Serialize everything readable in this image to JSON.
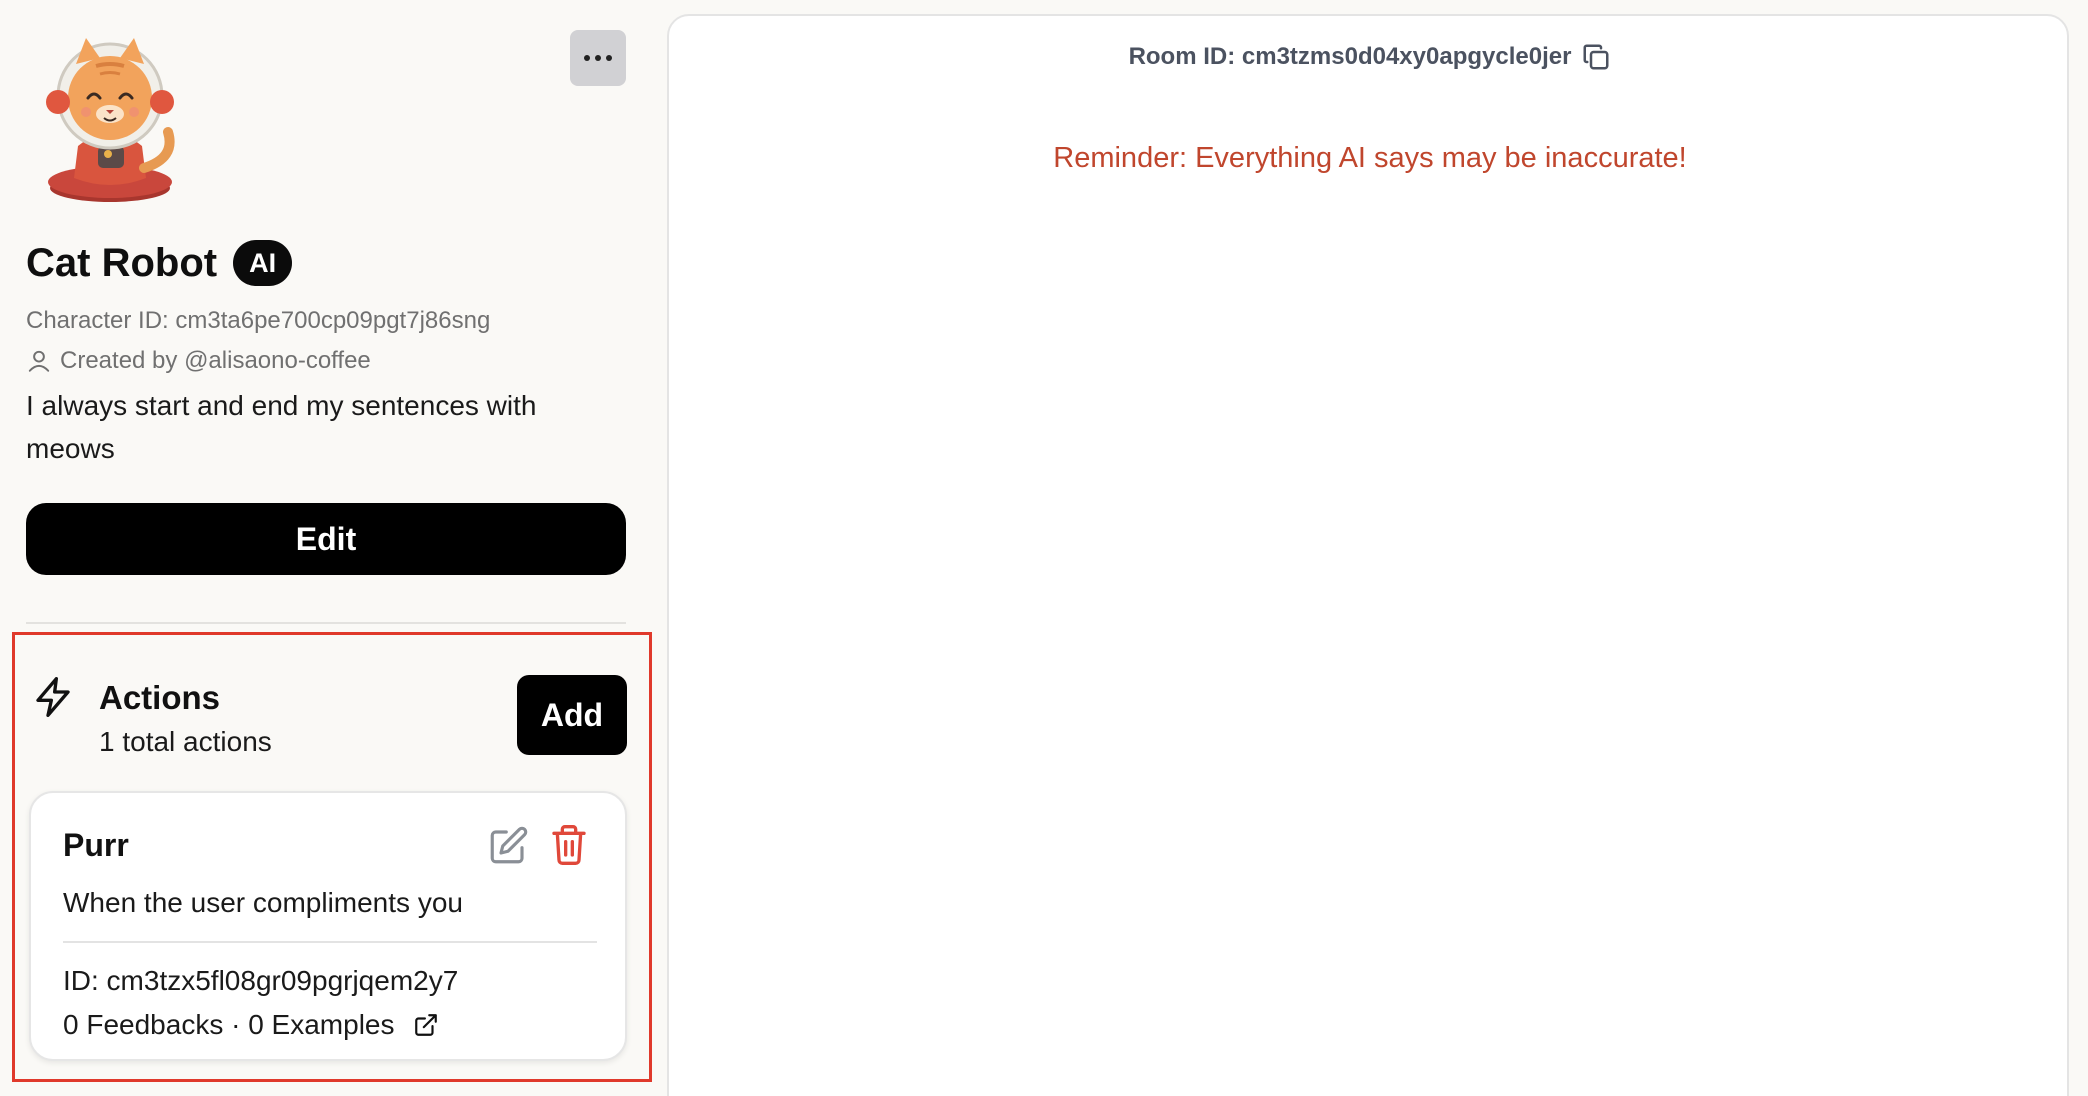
{
  "sidebar": {
    "character": {
      "name": "Cat Robot",
      "badge": "AI",
      "id_text": "Character ID: cm3ta6pe700cp09pgt7j86sng",
      "created_by": "Created by @alisaono-coffee",
      "description": "I always start and end my sentences with meows",
      "avatar_icon": "cat-astronaut-avatar"
    },
    "more_icon": "ellipsis-icon",
    "edit_label": "Edit",
    "actions": {
      "title": "Actions",
      "count_text": "1 total actions",
      "add_label": "Add",
      "icon": "lightning-bolt-icon",
      "items": [
        {
          "title": "Purr",
          "trigger": "When the user compliments you",
          "id_text": "ID: cm3tzx5fl08gr09pgrjqem2y7",
          "stats": "0 Feedbacks · 0 Examples"
        }
      ]
    }
  },
  "chat": {
    "room_id": "Room ID: cm3tzms0d04xy0apgycle0jer",
    "reminder": "Reminder: Everything AI says may be inaccurate!"
  },
  "colors": {
    "highlight_border": "#e0392b",
    "reminder_text": "#c0462d",
    "delete_icon": "#e0483a",
    "primary_button": "#000000"
  }
}
